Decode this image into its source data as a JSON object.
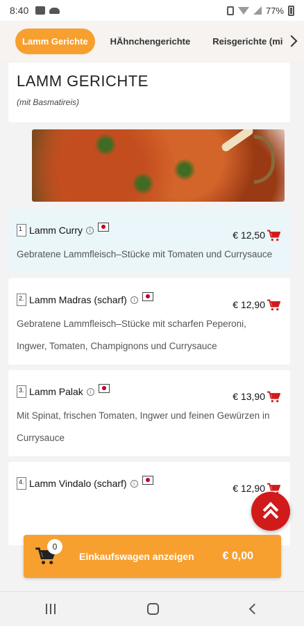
{
  "status_bar": {
    "time": "8:40",
    "battery": "77%",
    "icons": [
      "image-icon",
      "cloud-icon",
      "mute-icon",
      "wifi-icon",
      "signal-icon",
      "battery-icon"
    ]
  },
  "tabs": {
    "items": [
      {
        "label": "Lamm Gerichte",
        "active": true
      },
      {
        "label": "HÄhnchengerichte",
        "active": false
      },
      {
        "label": "Reisgerichte (mit",
        "active": false
      }
    ]
  },
  "section": {
    "title": "LAMM GERICHTE",
    "subtitle": "(mit Basmatireis)"
  },
  "items": [
    {
      "number": "1",
      "name": "Lamm Curry",
      "price": "€ 12,50",
      "description": "Gebratene Lammfleisch–Stücke mit Tomaten und Currysauce",
      "highlighted": true
    },
    {
      "number": "2.",
      "name": "Lamm Madras (scharf)",
      "price": "€ 12,90",
      "description": "Gebratene Lammfleisch–Stücke mit scharfen Peperoni, Ingwer, Tomaten, Champignons und Currysauce",
      "highlighted": false
    },
    {
      "number": "3.",
      "name": "Lamm Palak",
      "price": "€ 13,90",
      "description": "Mit Spinat, frischen Tomaten, Ingwer und feinen Gewürzen in Currysauce",
      "highlighted": false
    },
    {
      "number": "4.",
      "name": "Lamm Vindalo (scharf)",
      "price": "€ 12,90",
      "description": "",
      "highlighted": false
    }
  ],
  "cart": {
    "count": "0",
    "label": "Einkaufswagen anzeigen",
    "total": "€ 0,00"
  },
  "colors": {
    "accent": "#f7a030",
    "fab": "#d11a1a",
    "cart_icon": "#d11a1a",
    "highlight_row": "#eaf6fa"
  }
}
